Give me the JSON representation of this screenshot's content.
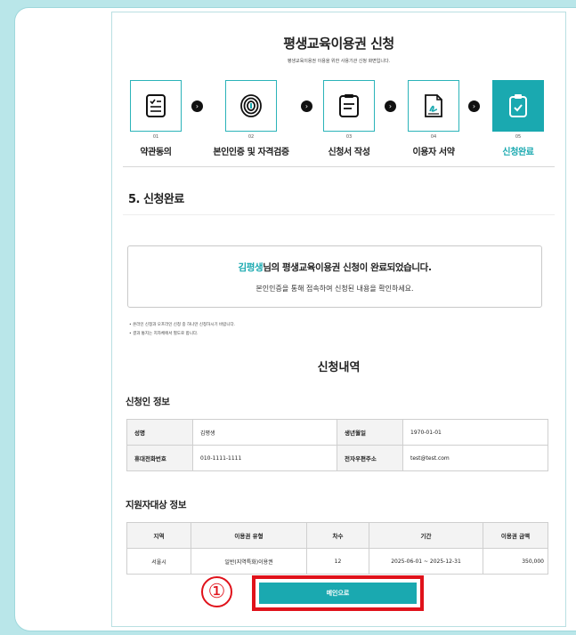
{
  "header": {
    "title": "평생교육이용권 신청",
    "subtitle": "평생교육이용권 이용을 위한 사용기관 신청 화면입니다."
  },
  "steps": [
    {
      "num": "01",
      "label": "약관동의",
      "icon": "checklist-icon"
    },
    {
      "num": "02",
      "label": "본인인증 및 자격검증",
      "icon": "fingerprint-icon"
    },
    {
      "num": "03",
      "label": "신청서 작성",
      "icon": "document-icon"
    },
    {
      "num": "04",
      "label": "이용자 서약",
      "icon": "signature-icon"
    },
    {
      "num": "05",
      "label": "신청완료",
      "icon": "clipboard-check-icon"
    }
  ],
  "section_title": "5. 신청완료",
  "completion": {
    "name": "김평생",
    "msg_part1": "님의 ",
    "msg_bold": "평생교육이용권 신청이 완료되었습니다.",
    "sub": "본인인증을 통해 접속하여 신청된 내용을 확인하세요."
  },
  "notes": [
    "• 온라인 신청과 오프라인 신청 중 하나만 신청하시기 바랍니다.",
    "• 결과 통지는 지자체에서 별도로 합니다."
  ],
  "details_title": "신청내역",
  "applicant": {
    "heading": "신청인 정보",
    "name_label": "성명",
    "name": "김평생",
    "birth_label": "생년월일",
    "birth": "1970-01-01",
    "phone_label": "휴대전화번호",
    "phone": "010-1111-1111",
    "email_label": "전자우편주소",
    "email": "test@test.com"
  },
  "support": {
    "heading": "지원자대상 정보",
    "columns": [
      "지역",
      "이용권 유형",
      "차수",
      "기간",
      "이용권 금액"
    ],
    "row": [
      "서울시",
      "일반(지역특화)이용권",
      "12",
      "2025-06-01 ~ 2025-12-31",
      "350,000"
    ]
  },
  "main_button": "메인으로",
  "marker": "①",
  "colors": {
    "accent": "#1aa9b0",
    "highlight": "#e0121b",
    "background": "#b9e6e9"
  }
}
